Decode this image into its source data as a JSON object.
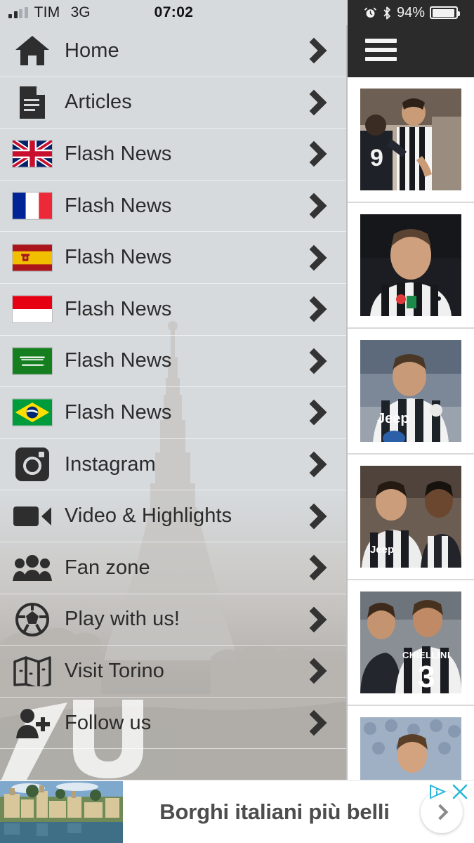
{
  "status_bar": {
    "carrier": "TIM",
    "network": "3G",
    "time": "07:02",
    "battery_percent": "94%",
    "alarm_icon": "alarm-clock-icon",
    "bluetooth_icon": "bluetooth-icon",
    "signal_icon": "signal-bars-icon",
    "battery_icon": "battery-icon",
    "battery_level": 94
  },
  "drawer": {
    "background_watermark": "mole-antonelliana-turin-skyline-silhouette",
    "logo_watermark": "juventus-ju-logo",
    "chevron_icon": "chevron-right-icon",
    "items": [
      {
        "label": "Home",
        "icon": "home-icon"
      },
      {
        "label": "Articles",
        "icon": "document-icon"
      },
      {
        "label": "Flash News",
        "icon": "flag-uk-icon"
      },
      {
        "label": "Flash News",
        "icon": "flag-france-icon"
      },
      {
        "label": "Flash News",
        "icon": "flag-spain-icon"
      },
      {
        "label": "Flash News",
        "icon": "flag-indonesia-icon"
      },
      {
        "label": "Flash News",
        "icon": "flag-saudi-arabia-icon"
      },
      {
        "label": "Flash News",
        "icon": "flag-brazil-icon"
      },
      {
        "label": "Instagram",
        "icon": "instagram-icon"
      },
      {
        "label": "Video & Highlights",
        "icon": "video-camera-icon"
      },
      {
        "label": "Fan zone",
        "icon": "people-group-icon"
      },
      {
        "label": "Play with us!",
        "icon": "soccer-ball-icon"
      },
      {
        "label": "Visit Torino",
        "icon": "map-icon"
      },
      {
        "label": "Follow us",
        "icon": "add-person-icon"
      }
    ]
  },
  "content_pane": {
    "menu_button_icon": "hamburger-menu-icon",
    "cards": [
      {
        "image": "juventus-players-striped-kit-photo",
        "alt_number": "9"
      },
      {
        "image": "juventus-player-portrait-photo",
        "alt_number": ""
      },
      {
        "image": "juventus-player-jeep-kit-photo",
        "alt_number": ""
      },
      {
        "image": "juventus-players-pjanic-douglas-photo",
        "alt_number": ""
      },
      {
        "image": "conte-chiellini-celebration-photo",
        "alt_number": "3",
        "jersey_name": "CHIELLINI"
      },
      {
        "image": "player-red-kit-crowd-photo",
        "alt_number": ""
      }
    ]
  },
  "ad": {
    "headline": "Borghi italiani più belli",
    "thumbnail": "italian-hilltop-village-photo",
    "cta_icon": "chevron-right-circle-icon",
    "adchoices_icon": "adchoices-icon",
    "close_icon": "close-x-icon"
  },
  "colors": {
    "status_bar_bg": "#d6dadd",
    "status_bar_dark": "#2b2b2b",
    "drawer_top": "#d6dadd",
    "drawer_bottom": "#a9a7a3",
    "text": "#2b2b2b",
    "header_dark": "#2b2b2b",
    "ad_accent": "#29b6d8",
    "ad_text": "#4d4d4d"
  }
}
